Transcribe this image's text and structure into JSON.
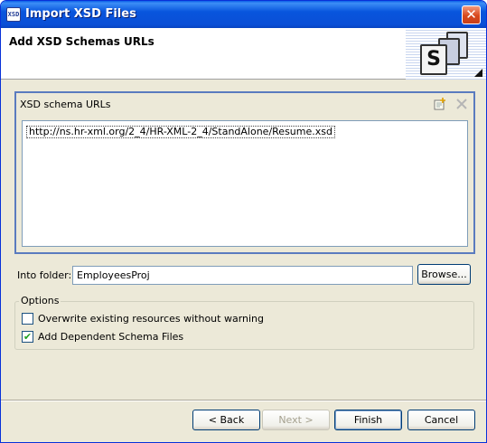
{
  "window": {
    "title": "Import XSD Files",
    "icon_text": "XSD",
    "close_symbol": "✕"
  },
  "header": {
    "title": "Add XSD Schemas URLs",
    "logo_letter": "S"
  },
  "schema_group": {
    "title": "XSD schema URLs",
    "urls": [
      "http://ns.hr-xml.org/2_4/HR-XML-2_4/StandAlone/Resume.xsd"
    ]
  },
  "folder": {
    "label": "Into folder:",
    "value": "EmployeesProj",
    "browse_label": "Browse..."
  },
  "options": {
    "legend": "Options",
    "overwrite": {
      "label": "Overwrite existing resources without warning",
      "checked": false
    },
    "dependent": {
      "label": "Add Dependent Schema Files",
      "checked": true,
      "mark": "✔"
    }
  },
  "buttons": {
    "back": "< Back",
    "next": "Next >",
    "finish": "Finish",
    "cancel": "Cancel"
  },
  "colors": {
    "titlebar": "#0a4fd6",
    "dialog_bg": "#ece9d8",
    "group_border": "#5a7bbf"
  }
}
